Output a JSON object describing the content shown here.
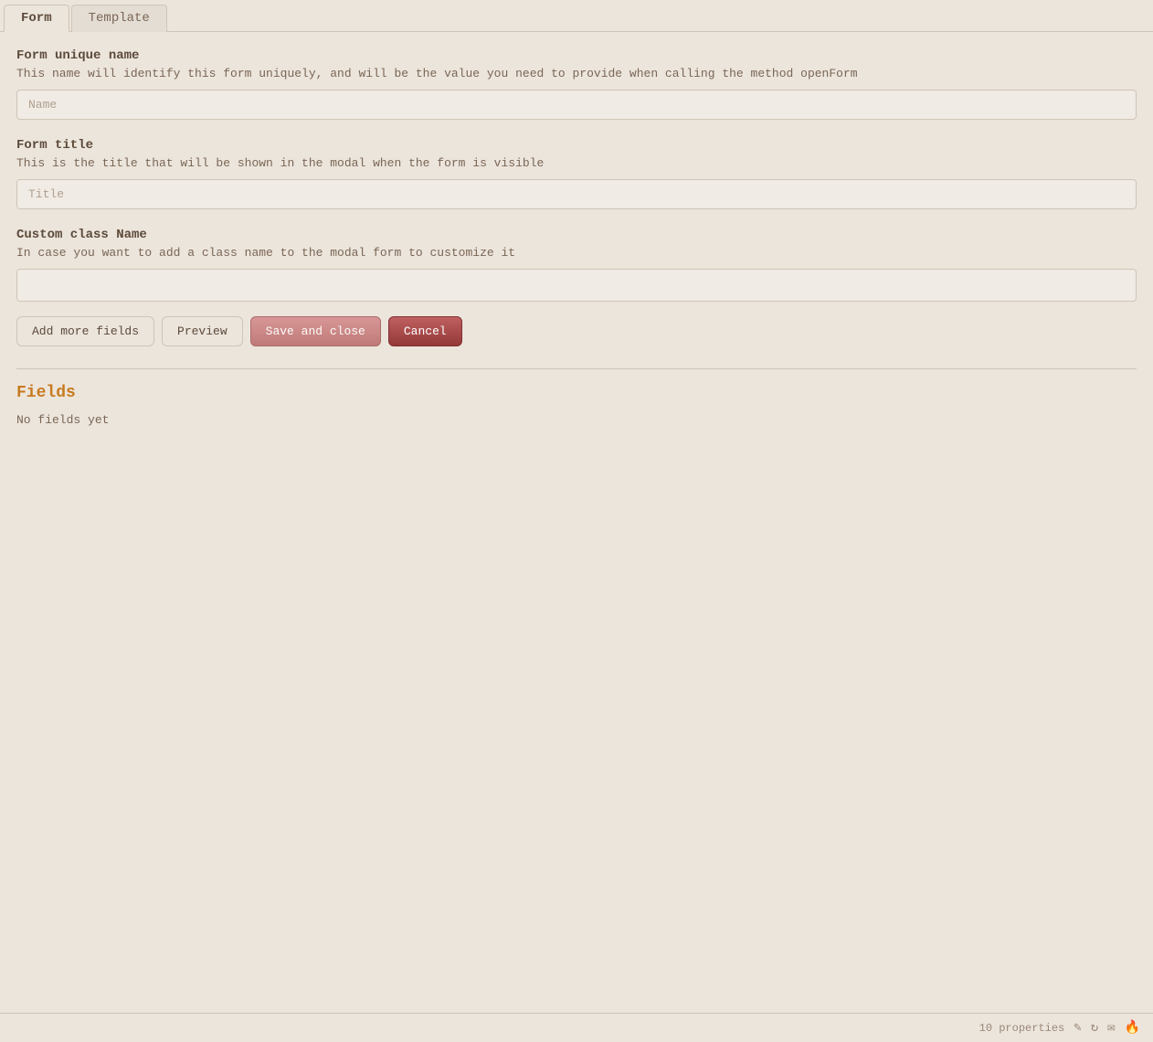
{
  "tabs": [
    {
      "id": "form",
      "label": "Form",
      "active": true
    },
    {
      "id": "template",
      "label": "Template",
      "active": false
    }
  ],
  "form": {
    "unique_name": {
      "label": "Form unique name",
      "description": "This name will identify this form uniquely, and will be the value you need to provide when calling the method openForm",
      "placeholder": "Name",
      "value": ""
    },
    "title": {
      "label": "Form title",
      "description": "This is the title that will be shown in the modal when the form is visible",
      "placeholder": "Title",
      "value": ""
    },
    "custom_class": {
      "label": "Custom class Name",
      "description": "In case you want to add a class name to the modal form to customize it",
      "placeholder": "",
      "value": ""
    }
  },
  "buttons": {
    "add_more_fields": "Add more fields",
    "preview": "Preview",
    "save_and_close": "Save and close",
    "cancel": "Cancel"
  },
  "fields_section": {
    "heading": "Fields",
    "empty_message": "No fields yet"
  },
  "status_bar": {
    "properties_count": "10 properties"
  }
}
